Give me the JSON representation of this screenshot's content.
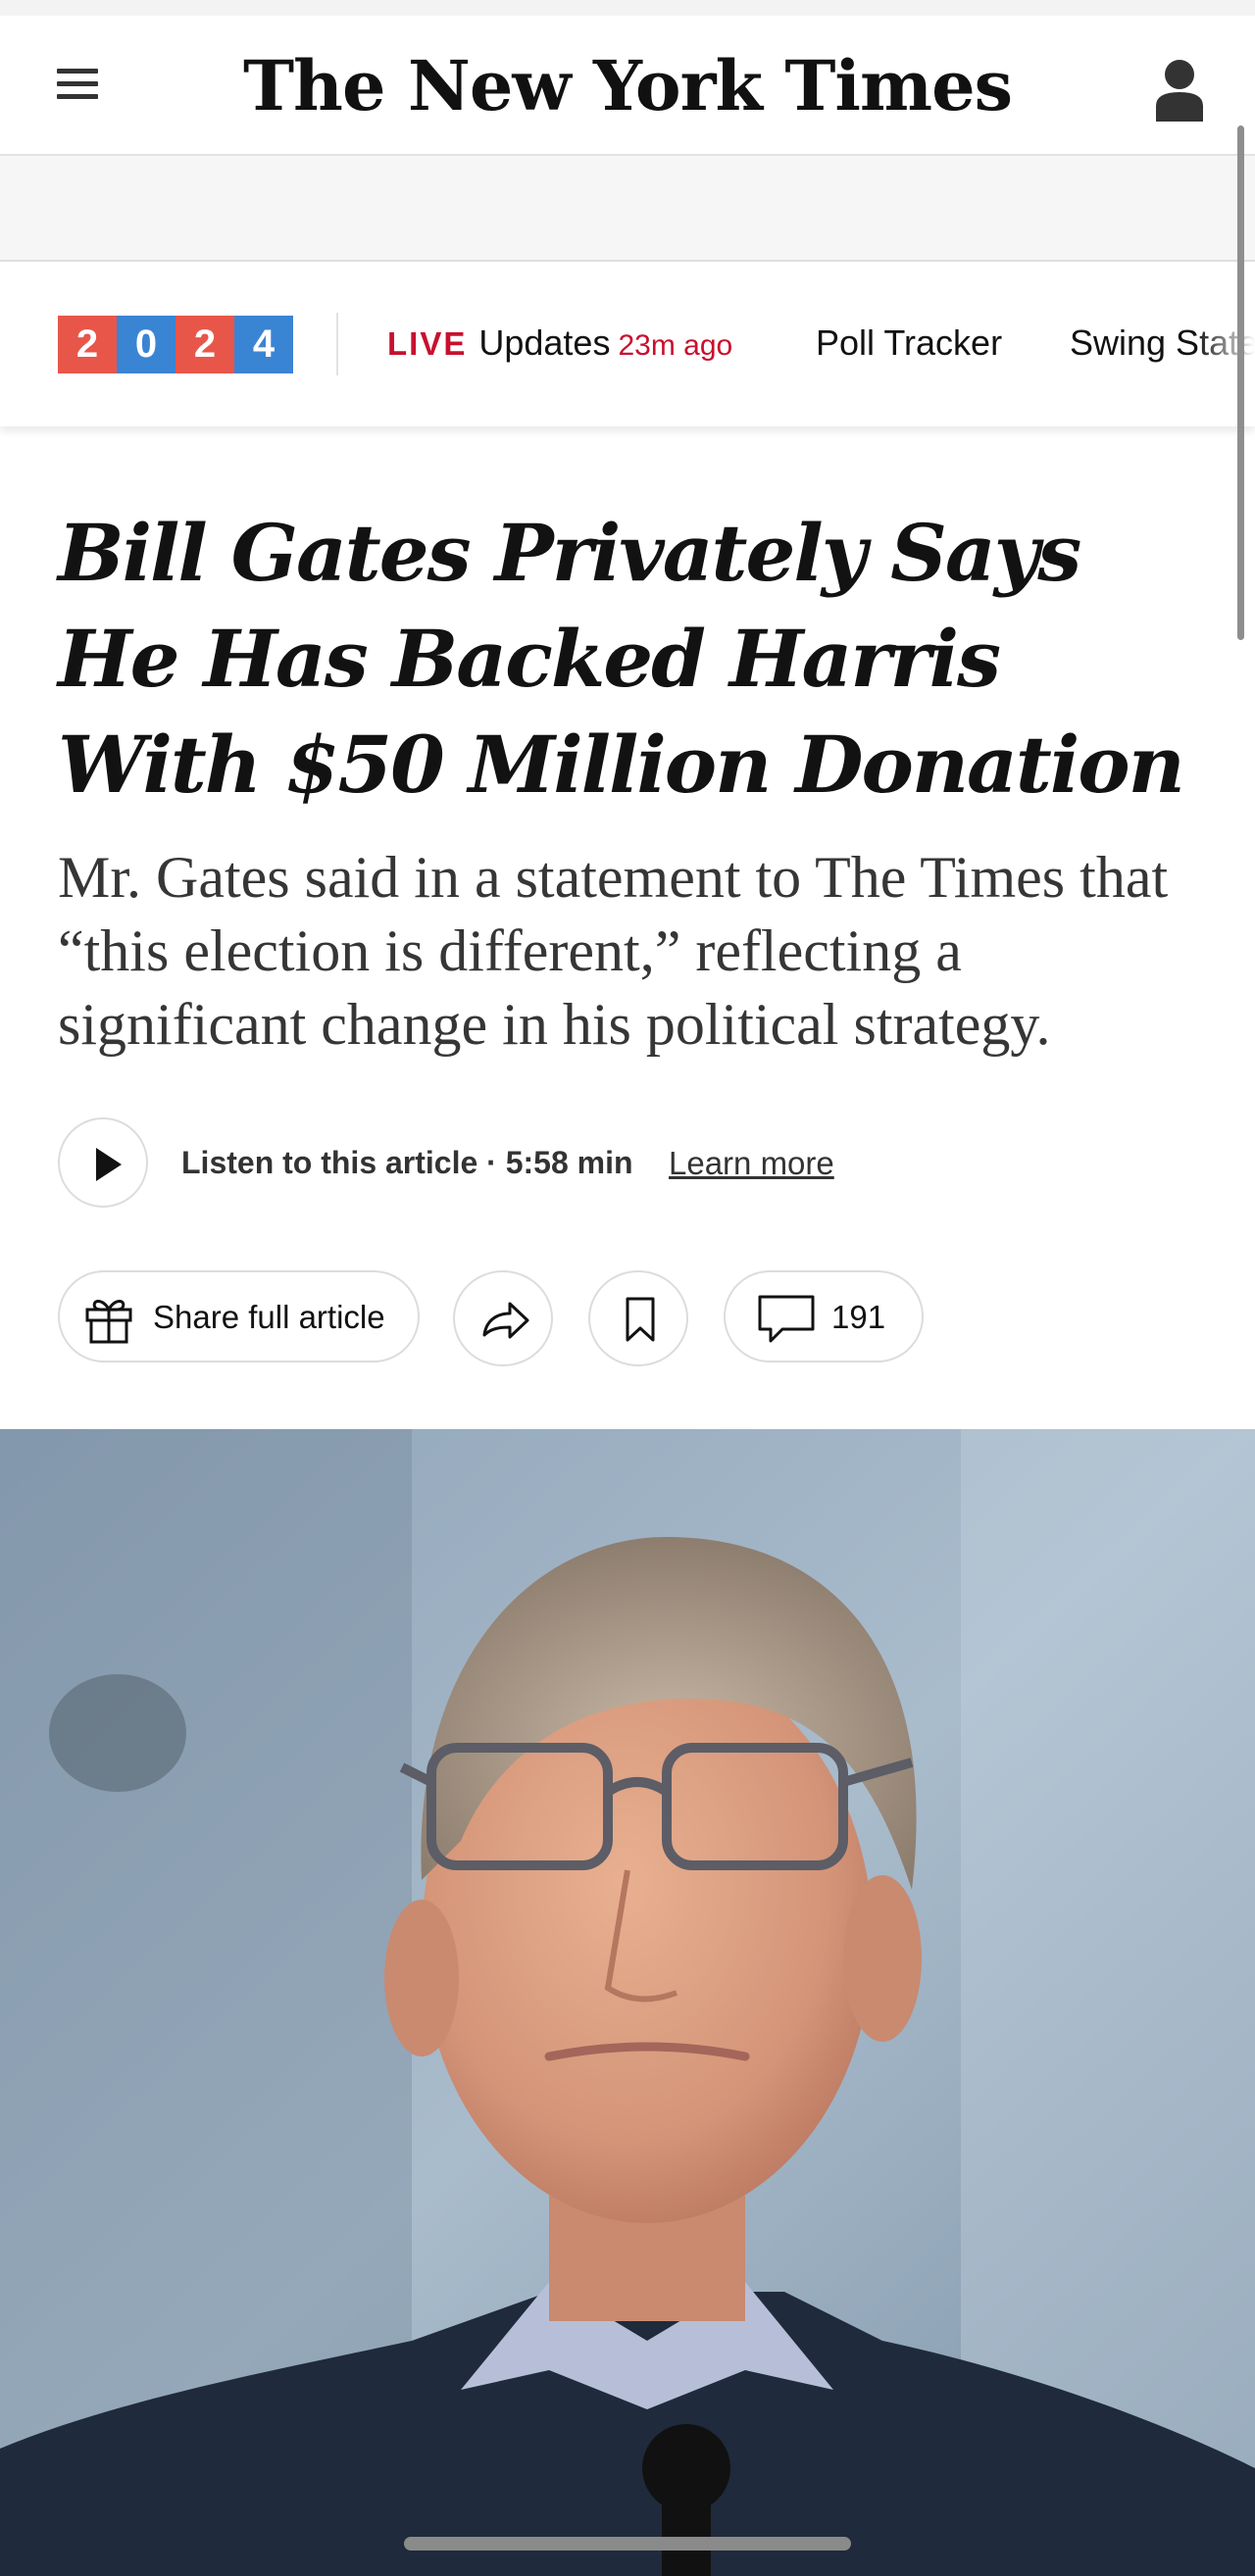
{
  "header": {
    "logo_text": "The New York Times",
    "menu_icon": "hamburger-icon",
    "account_icon": "user-icon"
  },
  "election_bar": {
    "year_digits": [
      "2",
      "0",
      "2",
      "4"
    ],
    "digit_colors": [
      "#e8564a",
      "#3a84d4",
      "#e8564a",
      "#3a84d4"
    ],
    "live_tag": "LIVE",
    "live_label": "Updates",
    "live_time": "23m ago",
    "links": [
      "Poll Tracker",
      "Swing States"
    ]
  },
  "article": {
    "headline": "Bill Gates Privately Says He Has Backed Harris With $50 Million Donation",
    "summary": "Mr. Gates said in a statement to The Times that “this election is different,” reflecting a significant change in his political strategy.",
    "audio": {
      "listen_text": "Listen to this article · 5:58 min",
      "learn_more": "Learn more"
    },
    "actions": {
      "share_full_label": "Share full article",
      "comment_count": "191"
    }
  },
  "colors": {
    "accent_red": "#c8102e",
    "text": "#121212"
  }
}
